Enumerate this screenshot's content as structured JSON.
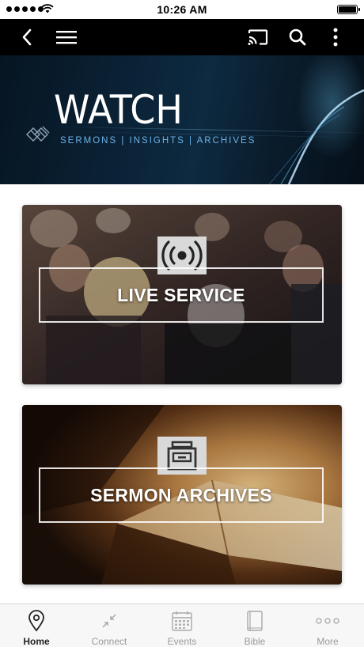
{
  "status_bar": {
    "time": "10:26 AM"
  },
  "nav": {
    "back_icon": "chevron-left-icon",
    "menu_icon": "hamburger-menu-icon",
    "cast_icon": "cast-icon",
    "search_icon": "search-icon",
    "more_icon": "vertical-dots-icon"
  },
  "hero": {
    "title": "WATCH",
    "subtitle": "SERMONS | INSIGHTS | ARCHIVES"
  },
  "cards": [
    {
      "label": "LIVE SERVICE",
      "icon": "broadcast-icon"
    },
    {
      "label": "SERMON ARCHIVES",
      "icon": "archive-icon"
    }
  ],
  "tabs": [
    {
      "label": "Home",
      "icon": "map-pin-icon",
      "active": true
    },
    {
      "label": "Connect",
      "icon": "collapse-arrows-icon",
      "active": false
    },
    {
      "label": "Events",
      "icon": "calendar-icon",
      "active": false
    },
    {
      "label": "Bible",
      "icon": "book-icon",
      "active": false
    },
    {
      "label": "More",
      "icon": "horizontal-dots-icon",
      "active": false
    }
  ],
  "colors": {
    "nav_background": "#000000",
    "hero_accent": "#6cb3e8",
    "tab_active": "#222222",
    "tab_inactive": "#9a9a9a"
  }
}
